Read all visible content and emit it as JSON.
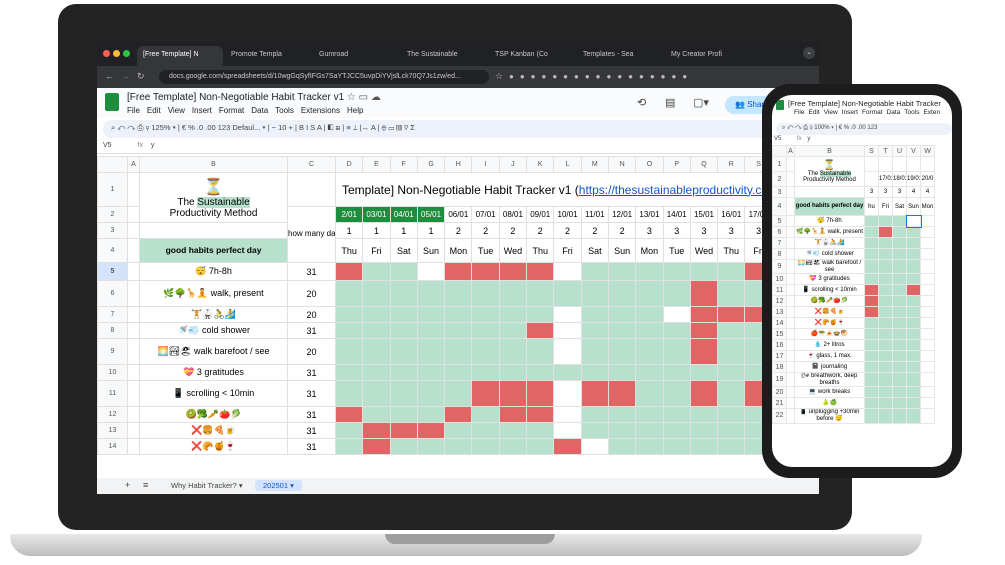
{
  "browser": {
    "tabs": [
      {
        "label": "[Free Template] N",
        "active": true
      },
      {
        "label": "Promote Templa",
        "active": false
      },
      {
        "label": "Gumroad",
        "active": false
      },
      {
        "label": "The Sustainable",
        "active": false
      },
      {
        "label": "TSP Kanban (Co",
        "active": false
      },
      {
        "label": "Templates - Sea",
        "active": false
      },
      {
        "label": "My Creator Profi",
        "active": false
      }
    ],
    "url": "docs.google.com/spreadsheets/d/10wgGqSyfIFGs7SaYTJCC5uvpDiYVjslLck70Q7Js1zw/ed..."
  },
  "sheets": {
    "title": "[Free Template] Non-Negotiable Habit Tracker v1",
    "menu": [
      "File",
      "Edit",
      "View",
      "Insert",
      "Format",
      "Data",
      "Tools",
      "Extensions",
      "Help"
    ],
    "share_label": "Share",
    "toolbar_text": "⌕  ↶  ↷  ⎙  ⚲   125% ▾  |  €  %  .0  .00  123  Defaul... ▾  |  −  10  +  |  B  I  S  A  |  ◧  ⊞  |  ≡  ⊥  |↔  A  |  ⊕  ▭  ▥  ⊽  Σ",
    "cell_ref": "V5",
    "formula_prefix": "fx",
    "formula_value": "y",
    "col_headers": [
      "A",
      "B",
      "C",
      "D",
      "E",
      "F",
      "G",
      "H",
      "I",
      "J",
      "K",
      "L",
      "M",
      "N",
      "O",
      "P",
      "Q",
      "R",
      "S",
      "T",
      "U"
    ],
    "row_numbers": [
      "1",
      "2",
      "3",
      "4",
      "5",
      "6",
      "7",
      "8",
      "9",
      "10",
      "11",
      "12",
      "13",
      "14"
    ],
    "brand_top": "The",
    "brand_highlight": "Sustainable",
    "brand_bottom": "Productivity Method",
    "sheet_title_prefix": "Template] Non-Negotiable Habit Tracker v1 (",
    "sheet_title_link": "https://thesustainableproductivity.com",
    "sheet_title_suffix": ")",
    "how_many_label": "how many days I'll do it?",
    "good_habits_label": "good habits perfect day",
    "dates": [
      "2/01",
      "03/01",
      "04/01",
      "05/01",
      "06/01",
      "07/01",
      "08/01",
      "09/01",
      "10/01",
      "11/01",
      "12/01",
      "13/01",
      "14/01",
      "15/01",
      "16/01",
      "17/01",
      "18/01"
    ],
    "weeks": [
      "1",
      "1",
      "1",
      "1",
      "2",
      "2",
      "2",
      "2",
      "2",
      "2",
      "2",
      "3",
      "3",
      "3",
      "3",
      "3",
      "3"
    ],
    "days": [
      "Thu",
      "Fri",
      "Sat",
      "Sun",
      "Mon",
      "Tue",
      "Wed",
      "Thu",
      "Fri",
      "Sat",
      "Sun",
      "Mon",
      "Tue",
      "Wed",
      "Thu",
      "Fri",
      "Sat"
    ],
    "habits": [
      {
        "label": "😴 7h-8h",
        "target": "31",
        "cells": "rggwrrrrwggggggrg"
      },
      {
        "label": "🌿🌳🦒🧘 walk, present",
        "target": "20",
        "cells": "gggggggggggggrggg"
      },
      {
        "label": "🏋🥋🚴🏄",
        "target": "20",
        "cells": "ggggggggwgggwrrrg"
      },
      {
        "label": "🚿💨 cold shower",
        "target": "31",
        "cells": "gggggggrwggggrggg"
      },
      {
        "label": "🌅🏞🏖 walk barefoot / see",
        "target": "20",
        "cells": "ggggggggwggggrggg"
      },
      {
        "label": "💝 3 gratitudes",
        "target": "31",
        "cells": "gggggggggggggggg g"
      },
      {
        "label": "📱 scrolling < 10min",
        "target": "31",
        "cells": "gggggrrrwrrggrgrr"
      },
      {
        "label": "🥝🥦🥕🍅🥬",
        "target": "31",
        "cells": "rgggrgrrwggggggg g"
      },
      {
        "label": "❌🍔🍕🍺",
        "target": "31",
        "cells": "grrrggggwggggggg g"
      },
      {
        "label": "❌🥐🍯🍷",
        "target": "31",
        "cells": "grggggggrwgggggg g"
      }
    ],
    "sheet_tabs": [
      {
        "label": "Why Habit Tracker? ▾",
        "active": false
      },
      {
        "label": "202501 ▾",
        "active": true
      }
    ],
    "add_sheet": "+",
    "all_sheets": "≡"
  },
  "phone": {
    "title": "[Free Template] Non-Negotiable Habit Tracker",
    "menu": [
      "File",
      "Edit",
      "View",
      "Insert",
      "Format",
      "Data",
      "Tools",
      "Exten"
    ],
    "toolbar_text": "⌕ ↶ ↷ ⎙ ⚲ 100% ▾ | € % .0 .00 123",
    "cell_ref": "V5",
    "formula_prefix": "fx",
    "formula_value": "y",
    "cols": [
      "A",
      "B",
      "S",
      "T",
      "U",
      "V",
      "W"
    ],
    "dates": [
      "17/01",
      "18/01",
      "19/01",
      "20/0"
    ],
    "weeks": [
      "3",
      "3",
      "3",
      "4",
      "4"
    ],
    "days": [
      "hu",
      "Fri",
      "Sat",
      "Sun",
      "Mon"
    ],
    "habits": [
      "😴 7h-8h",
      "🌿🌳🦒🧘 walk, present",
      "🏋🥋🚴🏄",
      "🚿💨 cold shower",
      "🌅🏞🏖 walk barefoot / see",
      "💝 3 gratitudes",
      "📱 scrolling < 10min",
      "🥝🥦🥕🍅🥬",
      "❌🍔🍕🍺",
      "❌🥐🍯🍷",
      "🍎🥗🍝🍲🥙",
      "💧 2+ litros",
      "🍷 glass, 1 max.",
      "📓 journaling",
      "🌬 breathwork, deep breaths",
      "💻 work breaks",
      "🍐🍏",
      "📱 unplugging +30min before 😴"
    ],
    "row_numbers": [
      "1",
      "2",
      "3",
      "4",
      "5",
      "6",
      "7",
      "8",
      "9",
      "10",
      "11",
      "12",
      "13",
      "14",
      "15",
      "16",
      "17",
      "18",
      "19",
      "20",
      "21",
      "22"
    ],
    "cells": [
      "gggrg",
      "grggg",
      "ggggg",
      "ggggg",
      "ggggg",
      "ggggg",
      "rggrg",
      "rgggg",
      "rgggg",
      "ggggg",
      "ggggg",
      "ggggg",
      "ggggg",
      "ggggg",
      "ggggg",
      "ggggg",
      "ggggg",
      "ggggg"
    ]
  }
}
